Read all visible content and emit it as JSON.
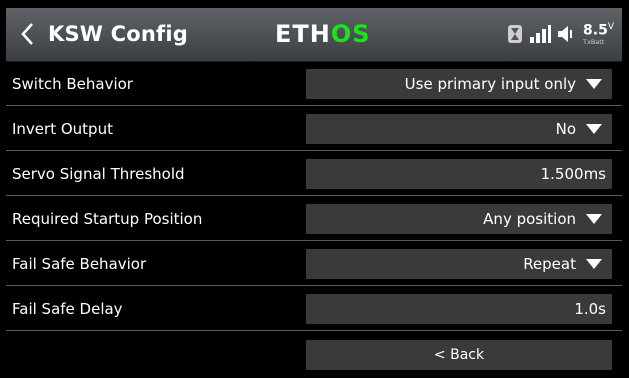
{
  "header": {
    "title": "KSW Config",
    "logo_left": "ETH",
    "logo_right": "OS",
    "battery_value": "8.5",
    "battery_unit": "V",
    "battery_label": "TxBatt"
  },
  "rows": [
    {
      "label": "Switch Behavior",
      "value": "Use primary input only",
      "dropdown": true
    },
    {
      "label": "Invert Output",
      "value": "No",
      "dropdown": true
    },
    {
      "label": "Servo Signal Threshold",
      "value": "1.500ms",
      "dropdown": false
    },
    {
      "label": "Required Startup Position",
      "value": "Any position",
      "dropdown": true
    },
    {
      "label": "Fail Safe Behavior",
      "value": "Repeat",
      "dropdown": true
    },
    {
      "label": "Fail Safe Delay",
      "value": "1.0s",
      "dropdown": false
    }
  ],
  "back_button_label": "< Back",
  "colors": {
    "accent_green": "#1be31b",
    "field_bg": "#3a3a3a",
    "scrollbar": "#2c4fd8"
  },
  "icons": [
    "chevron-left-icon",
    "hourglass-icon",
    "signal-bars-icon",
    "speaker-icon"
  ]
}
